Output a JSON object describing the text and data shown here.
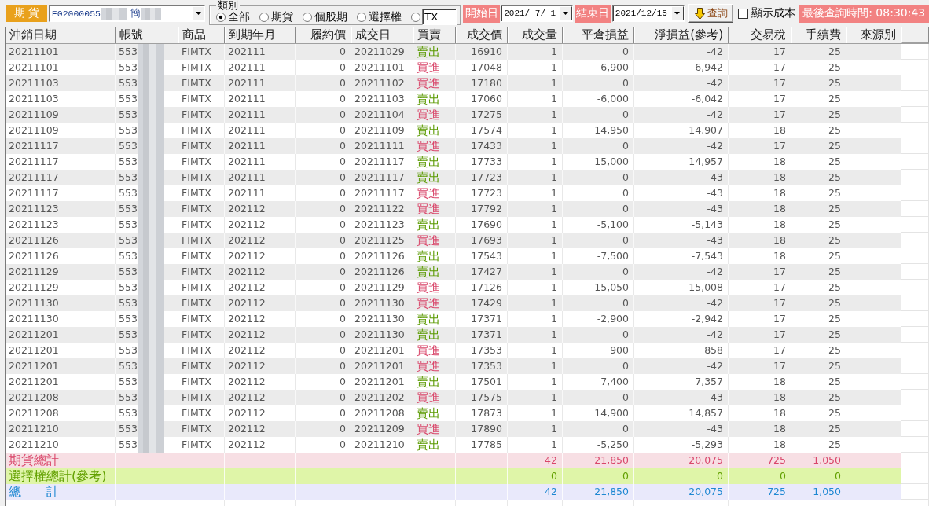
{
  "toolbar": {
    "market_label": "期 貨",
    "account_select": {
      "value": "F02000055",
      "name": "簡",
      "redacted": true
    },
    "category": {
      "title": "類別",
      "options": [
        {
          "kind": "radio",
          "label": "全部",
          "selected": true
        },
        {
          "kind": "radio",
          "label": "期貨",
          "selected": false
        },
        {
          "kind": "radio",
          "label": "個股期",
          "selected": false
        },
        {
          "kind": "radio",
          "label": "選擇權",
          "selected": false
        },
        {
          "kind": "input",
          "value": "TX",
          "selected": false
        }
      ]
    },
    "start_date": {
      "label": "開始日",
      "value": "2021/ 7/ 1"
    },
    "end_date": {
      "label": "結束日",
      "value": "2021/12/15"
    },
    "query_button": "查詢",
    "show_cost": {
      "label": "顯示成本",
      "checked": false
    },
    "last_query_time": "最後查詢時間: 08:30:43"
  },
  "table": {
    "account_redacted": true,
    "columns": [
      "沖銷日期",
      "帳號",
      "商品",
      "到期年月",
      "履約價",
      "成交日",
      "買賣",
      "成交價",
      "成交量",
      "平倉損益",
      "淨損益(參考)",
      "交易稅",
      "手續費",
      "來源別"
    ],
    "rows": [
      {
        "kind": "sell",
        "cells": [
          "20211101",
          "553",
          "FIMTX",
          "202111",
          "0",
          "20211029",
          "賣出",
          "16910",
          "1",
          "0",
          "-42",
          "17",
          "25"
        ]
      },
      {
        "kind": "buy",
        "cells": [
          "20211101",
          "553",
          "FIMTX",
          "202111",
          "0",
          "20211101",
          "買進",
          "17048",
          "1",
          "-6,900",
          "-6,942",
          "17",
          "25"
        ]
      },
      {
        "kind": "buy",
        "cells": [
          "20211103",
          "553",
          "FIMTX",
          "202111",
          "0",
          "20211102",
          "買進",
          "17180",
          "1",
          "0",
          "-42",
          "17",
          "25"
        ]
      },
      {
        "kind": "sell",
        "cells": [
          "20211103",
          "553",
          "FIMTX",
          "202111",
          "0",
          "20211103",
          "賣出",
          "17060",
          "1",
          "-6,000",
          "-6,042",
          "17",
          "25"
        ]
      },
      {
        "kind": "buy",
        "cells": [
          "20211109",
          "553",
          "FIMTX",
          "202111",
          "0",
          "20211104",
          "買進",
          "17275",
          "1",
          "0",
          "-42",
          "17",
          "25"
        ]
      },
      {
        "kind": "sell",
        "cells": [
          "20211109",
          "553",
          "FIMTX",
          "202111",
          "0",
          "20211109",
          "賣出",
          "17574",
          "1",
          "14,950",
          "14,907",
          "18",
          "25"
        ]
      },
      {
        "kind": "buy",
        "cells": [
          "20211117",
          "553",
          "FIMTX",
          "202111",
          "0",
          "20211111",
          "買進",
          "17433",
          "1",
          "0",
          "-42",
          "17",
          "25"
        ]
      },
      {
        "kind": "sell",
        "cells": [
          "20211117",
          "553",
          "FIMTX",
          "202111",
          "0",
          "20211117",
          "賣出",
          "17733",
          "1",
          "15,000",
          "14,957",
          "18",
          "25"
        ]
      },
      {
        "kind": "sell",
        "cells": [
          "20211117",
          "553",
          "FIMTX",
          "202111",
          "0",
          "20211117",
          "賣出",
          "17723",
          "1",
          "0",
          "-43",
          "18",
          "25"
        ]
      },
      {
        "kind": "buy",
        "cells": [
          "20211117",
          "553",
          "FIMTX",
          "202111",
          "0",
          "20211117",
          "買進",
          "17723",
          "1",
          "0",
          "-43",
          "18",
          "25"
        ]
      },
      {
        "kind": "buy",
        "cells": [
          "20211123",
          "553",
          "FIMTX",
          "202112",
          "0",
          "20211122",
          "買進",
          "17792",
          "1",
          "0",
          "-43",
          "18",
          "25"
        ]
      },
      {
        "kind": "sell",
        "cells": [
          "20211123",
          "553",
          "FIMTX",
          "202112",
          "0",
          "20211123",
          "賣出",
          "17690",
          "1",
          "-5,100",
          "-5,143",
          "18",
          "25"
        ]
      },
      {
        "kind": "buy",
        "cells": [
          "20211126",
          "553",
          "FIMTX",
          "202112",
          "0",
          "20211125",
          "買進",
          "17693",
          "1",
          "0",
          "-43",
          "18",
          "25"
        ]
      },
      {
        "kind": "sell",
        "cells": [
          "20211126",
          "553",
          "FIMTX",
          "202112",
          "0",
          "20211126",
          "賣出",
          "17543",
          "1",
          "-7,500",
          "-7,543",
          "18",
          "25"
        ]
      },
      {
        "kind": "sell",
        "cells": [
          "20211129",
          "553",
          "FIMTX",
          "202112",
          "0",
          "20211126",
          "賣出",
          "17427",
          "1",
          "0",
          "-42",
          "17",
          "25"
        ]
      },
      {
        "kind": "buy",
        "cells": [
          "20211129",
          "553",
          "FIMTX",
          "202112",
          "0",
          "20211129",
          "買進",
          "17126",
          "1",
          "15,050",
          "15,008",
          "17",
          "25"
        ]
      },
      {
        "kind": "buy",
        "cells": [
          "20211130",
          "553",
          "FIMTX",
          "202112",
          "0",
          "20211130",
          "買進",
          "17429",
          "1",
          "0",
          "-42",
          "17",
          "25"
        ]
      },
      {
        "kind": "sell",
        "cells": [
          "20211130",
          "553",
          "FIMTX",
          "202112",
          "0",
          "20211130",
          "賣出",
          "17371",
          "1",
          "-2,900",
          "-2,942",
          "17",
          "25"
        ]
      },
      {
        "kind": "sell",
        "cells": [
          "20211201",
          "553",
          "FIMTX",
          "202112",
          "0",
          "20211130",
          "賣出",
          "17371",
          "1",
          "0",
          "-42",
          "17",
          "25"
        ]
      },
      {
        "kind": "buy",
        "cells": [
          "20211201",
          "553",
          "FIMTX",
          "202112",
          "0",
          "20211201",
          "買進",
          "17353",
          "1",
          "900",
          "858",
          "17",
          "25"
        ]
      },
      {
        "kind": "buy",
        "cells": [
          "20211201",
          "553",
          "FIMTX",
          "202112",
          "0",
          "20211201",
          "買進",
          "17353",
          "1",
          "0",
          "-42",
          "17",
          "25"
        ]
      },
      {
        "kind": "sell",
        "cells": [
          "20211201",
          "553",
          "FIMTX",
          "202112",
          "0",
          "20211201",
          "賣出",
          "17501",
          "1",
          "7,400",
          "7,357",
          "18",
          "25"
        ]
      },
      {
        "kind": "buy",
        "cells": [
          "20211208",
          "553",
          "FIMTX",
          "202112",
          "0",
          "20211202",
          "買進",
          "17575",
          "1",
          "0",
          "-43",
          "18",
          "25"
        ]
      },
      {
        "kind": "sell",
        "cells": [
          "20211208",
          "553",
          "FIMTX",
          "202112",
          "0",
          "20211208",
          "賣出",
          "17873",
          "1",
          "14,900",
          "14,857",
          "18",
          "25"
        ]
      },
      {
        "kind": "buy",
        "cells": [
          "20211210",
          "553",
          "FIMTX",
          "202112",
          "0",
          "20211209",
          "買進",
          "17890",
          "1",
          "0",
          "-43",
          "18",
          "25"
        ]
      },
      {
        "kind": "sell",
        "cells": [
          "20211210",
          "553",
          "FIMTX",
          "202112",
          "0",
          "20211210",
          "賣出",
          "17785",
          "1",
          "-5,250",
          "-5,293",
          "18",
          "25"
        ]
      }
    ]
  },
  "totals": [
    {
      "kind": "futures",
      "label": "期貨總計",
      "values": [
        "42",
        "21,850",
        "20,075",
        "725",
        "1,050"
      ]
    },
    {
      "kind": "options",
      "label": "選擇權總計(參考)",
      "values": [
        "0",
        "0",
        "0",
        "0",
        "0"
      ]
    },
    {
      "kind": "total",
      "label": "總　　計",
      "values": [
        "42",
        "21,850",
        "20,075",
        "725",
        "1,050"
      ]
    }
  ]
}
